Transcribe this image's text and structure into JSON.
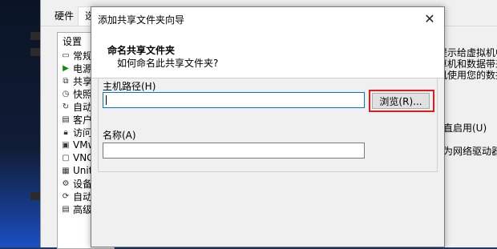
{
  "parent": {
    "tabs": [
      {
        "label": "硬件"
      },
      {
        "label": "选"
      }
    ],
    "tree": {
      "header": "设置",
      "items": [
        {
          "label": "常规",
          "icon": "window-icon"
        },
        {
          "label": "电源",
          "icon": "play-icon"
        },
        {
          "label": "共享",
          "icon": "share-icon"
        },
        {
          "label": "快照",
          "icon": "clock-icon"
        },
        {
          "label": "自动",
          "icon": "refresh-icon"
        },
        {
          "label": "客户",
          "icon": "folder-icon"
        },
        {
          "label": "访问",
          "icon": "lock-icon"
        },
        {
          "label": "VMw",
          "icon": "vm-icon"
        },
        {
          "label": "VNC",
          "icon": "vnc-icon"
        },
        {
          "label": "Unity",
          "icon": "unity-icon"
        },
        {
          "label": "设备",
          "icon": "devices-icon"
        },
        {
          "label": "自动",
          "icon": "auto-icon"
        },
        {
          "label": "高级",
          "icon": "advanced-icon"
        }
      ]
    },
    "right_texts": {
      "line1": "提示给虚拟机中",
      "line2": "算机和数据带来",
      "line3": "机使用您的数据",
      "enable": "直启用(U)",
      "drive": "为网络驱动器("
    }
  },
  "dialog": {
    "title": "添加共享文件夹向导",
    "close_glyph": "✕",
    "header_title": "命名共享文件夹",
    "header_subtitle": "如何命名此共享文件夹?",
    "host_path_label": "主机路径(H)",
    "host_path_value": "",
    "browse_label": "浏览(R)...",
    "name_label": "名称(A)",
    "name_value": ""
  },
  "colors": {
    "highlight": "#e01b1b",
    "focus": "#0078d7"
  }
}
